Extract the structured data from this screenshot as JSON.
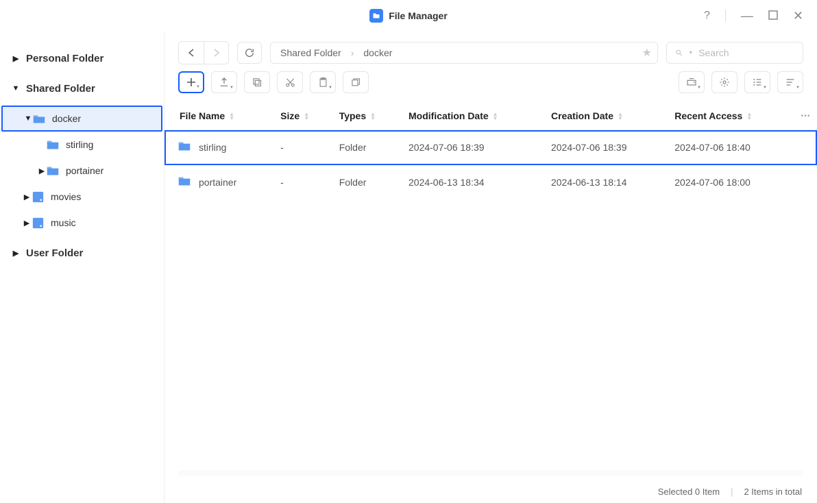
{
  "title": "File Manager",
  "sidebar": {
    "personal": "Personal Folder",
    "shared": "Shared Folder",
    "user": "User Folder",
    "docker": "docker",
    "stirling": "stirling",
    "portainer": "portainer",
    "movies": "movies",
    "music": "music"
  },
  "breadcrumb": {
    "p0": "Shared Folder",
    "p1": "docker"
  },
  "search": {
    "placeholder": "Search"
  },
  "columns": {
    "name": "File Name",
    "size": "Size",
    "types": "Types",
    "mod": "Modification Date",
    "created": "Creation Date",
    "access": "Recent Access"
  },
  "rows": [
    {
      "name": "stirling",
      "size": "-",
      "types": "Folder",
      "mod": "2024-07-06 18:39",
      "created": "2024-07-06 18:39",
      "access": "2024-07-06 18:40",
      "highlighted": true
    },
    {
      "name": "portainer",
      "size": "-",
      "types": "Folder",
      "mod": "2024-06-13 18:34",
      "created": "2024-06-13 18:14",
      "access": "2024-07-06 18:00",
      "highlighted": false
    }
  ],
  "status": {
    "selected": "Selected 0 Item",
    "total": "2 Items in total"
  }
}
